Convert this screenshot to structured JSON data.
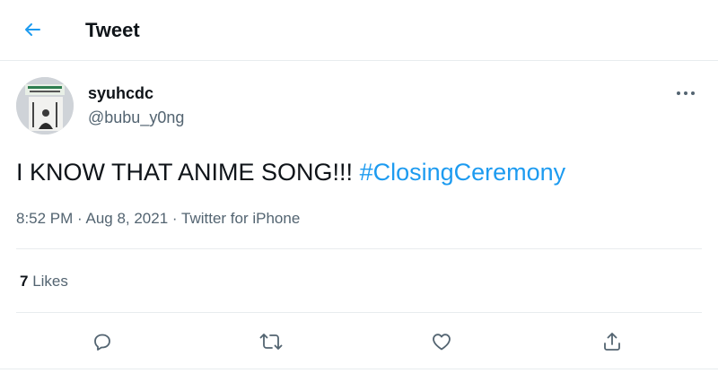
{
  "header": {
    "title": "Tweet"
  },
  "tweet": {
    "display_name": "syuhcdc",
    "handle": "@bubu_y0ng",
    "text": "I KNOW THAT ANIME SONG!!! ",
    "hashtag": "#ClosingCeremony",
    "time": "8:52 PM",
    "date": "Aug 8, 2021",
    "source": "Twitter for iPhone",
    "likes_count": "7",
    "likes_label": "Likes"
  },
  "colors": {
    "accent": "#1d9bf0",
    "text": "#0f1419",
    "muted": "#536471"
  },
  "icons": [
    "back-arrow-icon",
    "more-icon",
    "reply-icon",
    "retweet-icon",
    "like-icon",
    "share-icon"
  ]
}
